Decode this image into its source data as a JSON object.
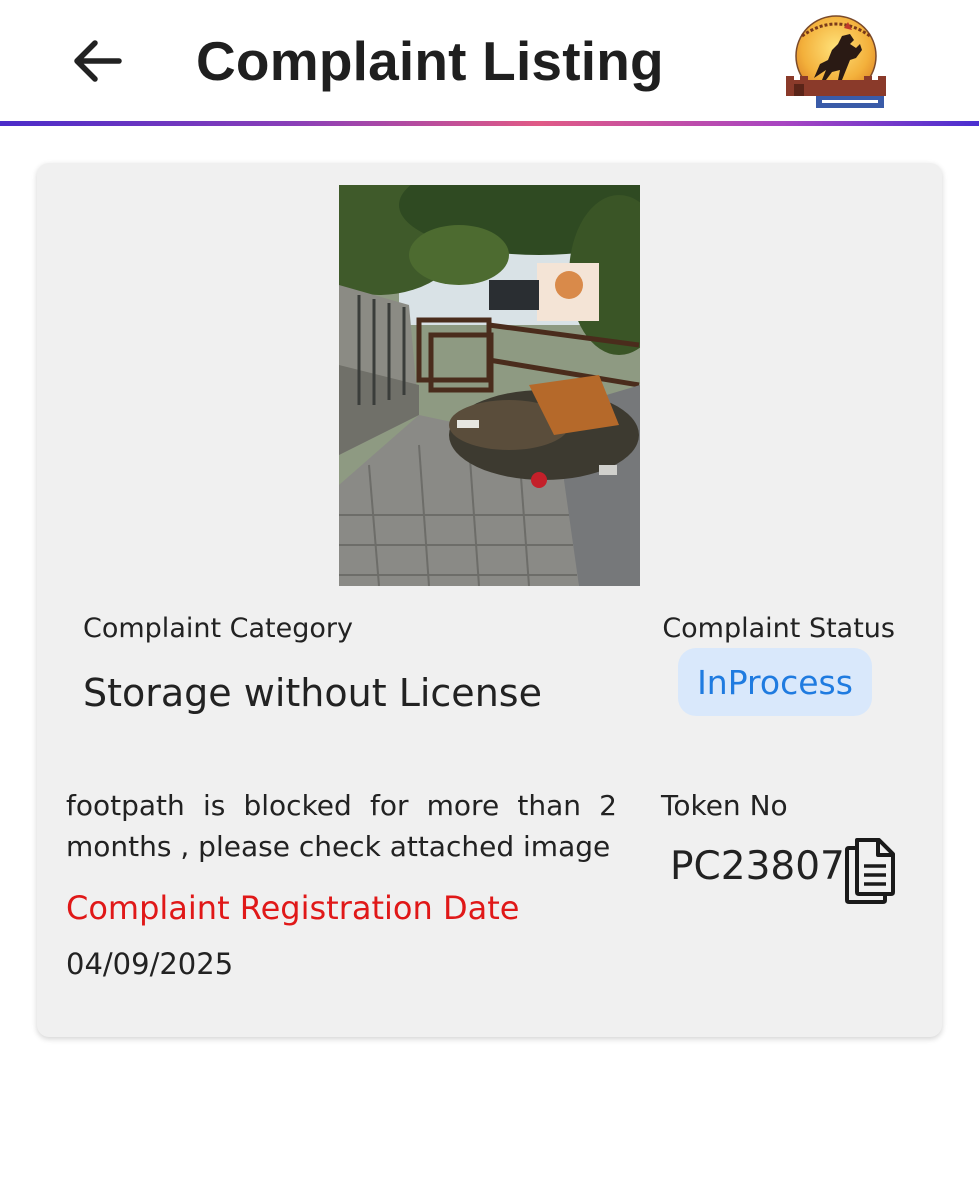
{
  "header": {
    "back_icon": "arrow-left-icon",
    "title": "Complaint Listing",
    "logo": "municipal-corporation-logo"
  },
  "theme": {
    "divider_gradient": [
      "#4b2cc9",
      "#e05a86",
      "#4a2fd0"
    ],
    "status_bg": "#d9e8fb",
    "status_text": "#1f7be0",
    "date_label_color": "#e01818",
    "card_bg": "#f0f0f0"
  },
  "complaint": {
    "photo": "complaint-photo",
    "category_label": "Complaint Category",
    "category_value": "Storage without License",
    "status_label": "Complaint Status",
    "status_value": "InProcess",
    "description": "footpath is blocked for more than 2 months , please check attached image",
    "token_label": "Token No",
    "token_value": "PC23807",
    "copy_icon": "copy-document-icon",
    "registration_label": "Complaint Registration Date",
    "registration_date": "04/09/2025"
  }
}
